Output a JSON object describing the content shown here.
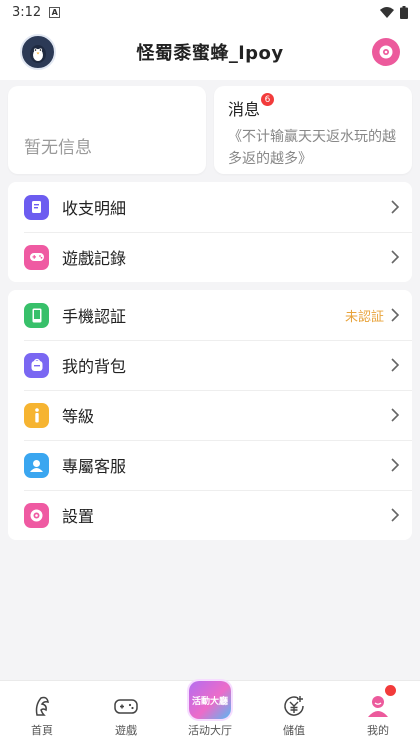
{
  "status_bar": {
    "time": "3:12",
    "notif_letter": "A"
  },
  "header": {
    "title": "怪蜀黍蜜蜂_lpoy"
  },
  "cards": {
    "left": {
      "faded_title": "",
      "empty_text": "暂无信息"
    },
    "right": {
      "title": "消息",
      "badge": "6",
      "body": "《不计输赢天天返水玩的越多返的越多》"
    }
  },
  "menu_group_1": [
    {
      "label": "收支明細",
      "icon": "ledger-icon",
      "color": "#6c5cf0"
    },
    {
      "label": "遊戲記錄",
      "icon": "gamepad-icon",
      "color": "#ef5aa2"
    }
  ],
  "menu_group_2": [
    {
      "label": "手機認証",
      "icon": "phone-icon",
      "color": "#38c06a",
      "status": "未認証"
    },
    {
      "label": "我的背包",
      "icon": "backpack-icon",
      "color": "#7a67f2"
    },
    {
      "label": "等級",
      "icon": "info-icon",
      "color": "#f6b431"
    },
    {
      "label": "專屬客服",
      "icon": "support-icon",
      "color": "#3aa6f0"
    },
    {
      "label": "設置",
      "icon": "gear-icon",
      "color": "#ef5aa2"
    }
  ],
  "tabbar": [
    {
      "label": "首頁",
      "icon": "home-icon"
    },
    {
      "label": "遊戲",
      "icon": "gamepad-tab-icon"
    },
    {
      "label": "活动大厅",
      "icon": "event-hall-icon",
      "icon_text": "活動大廳"
    },
    {
      "label": "儲值",
      "icon": "deposit-icon"
    },
    {
      "label": "我的",
      "icon": "profile-icon",
      "has_dot": true
    }
  ],
  "colors": {
    "accent_pink": "#ec5a9c",
    "badge_red": "#f23b3b",
    "status_orange": "#e8a33b"
  }
}
